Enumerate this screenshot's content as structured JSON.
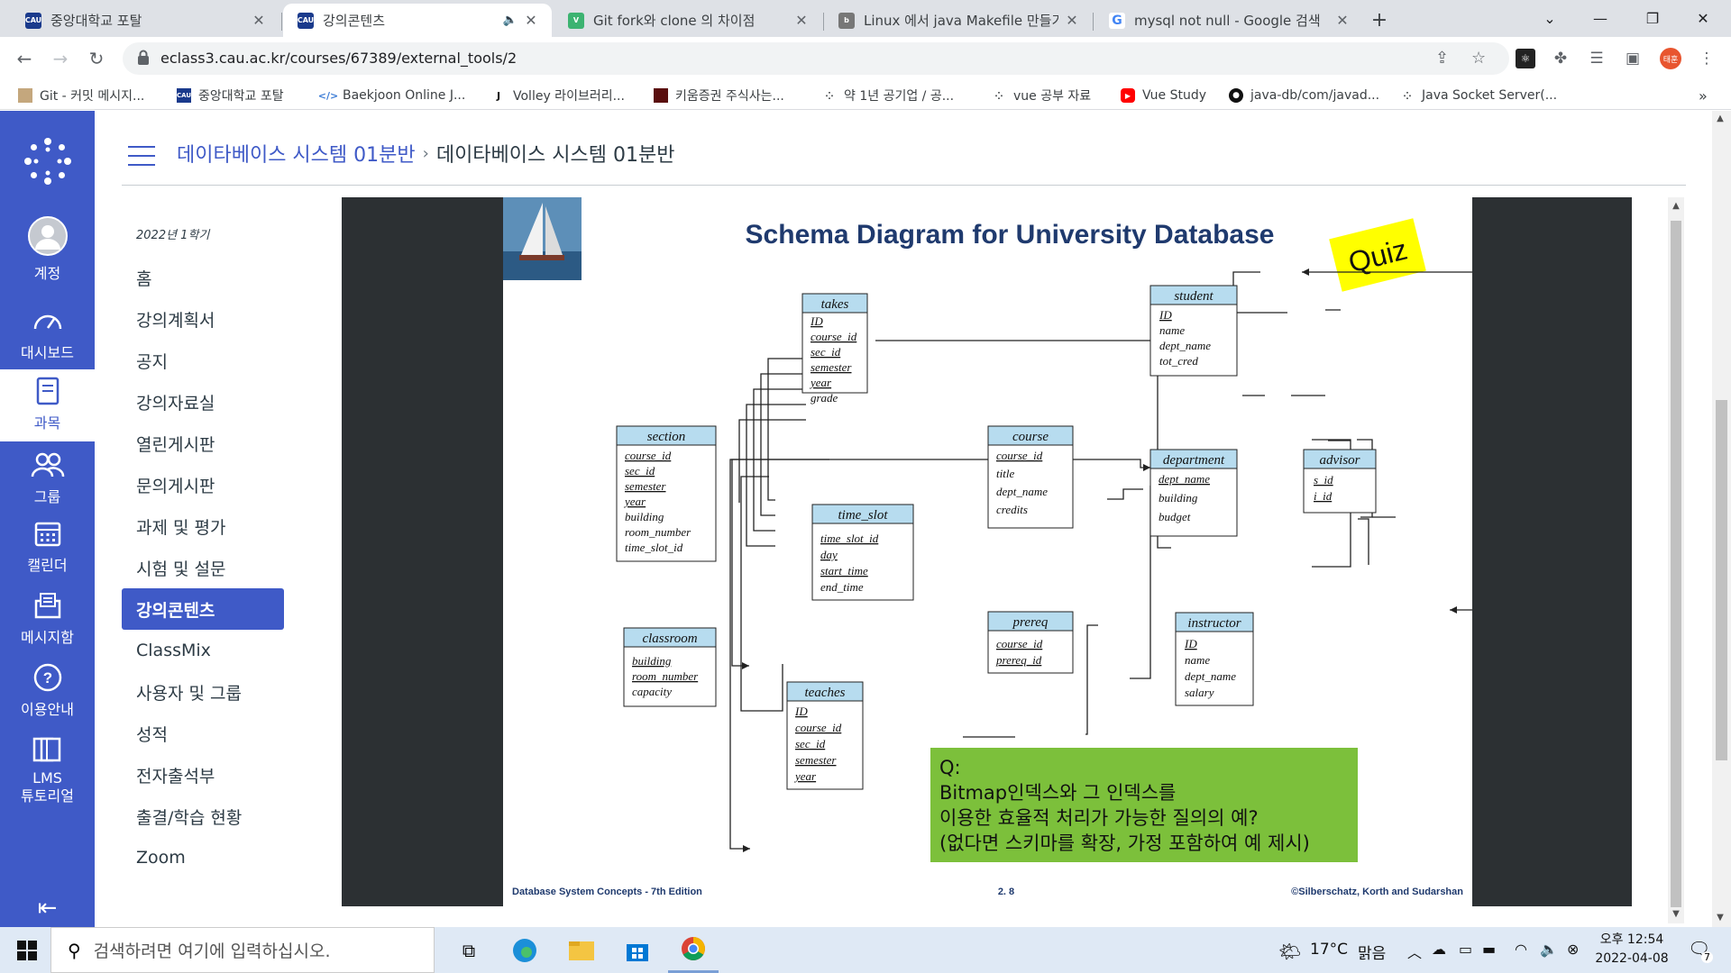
{
  "browser": {
    "tabs": [
      {
        "title": "중앙대학교 포탈",
        "favicon": "CAU",
        "color": "#1a3a8c",
        "active": false
      },
      {
        "title": "강의콘텐츠",
        "favicon": "CAU",
        "color": "#1a3a8c",
        "active": true,
        "audio": true
      },
      {
        "title": "Git fork와 clone 의 차이점",
        "favicon": "V",
        "color": "#3cb371",
        "active": false
      },
      {
        "title": "Linux 에서 java Makefile 만들기",
        "favicon": "blog",
        "color": "#555555",
        "active": false
      },
      {
        "title": "mysql not null - Google 검색",
        "favicon": "G",
        "color": "#4285f4",
        "active": false
      }
    ],
    "url": "eclass3.cau.ac.kr/courses/67389/external_tools/2",
    "profile_initials": "태훈",
    "bookmarks": [
      {
        "label": "Git - 커밋 메시지...",
        "icon": "git-icon"
      },
      {
        "label": "중앙대학교 포탈",
        "icon": "CAU"
      },
      {
        "label": "Baekjoon Online J...",
        "icon": "code-icon"
      },
      {
        "label": "Volley 라이브러리...",
        "icon": "J"
      },
      {
        "label": "키움증권 주식사는...",
        "icon": "image-icon"
      },
      {
        "label": "약 1년 공기업 / 공...",
        "icon": "dots-icon"
      },
      {
        "label": "vue 공부 자료",
        "icon": "dots-icon"
      },
      {
        "label": "Vue Study",
        "icon": "youtube-icon"
      },
      {
        "label": "java-db/com/javad...",
        "icon": "github-icon"
      },
      {
        "label": "Java Socket Server(...",
        "icon": "dots-icon"
      }
    ]
  },
  "global_nav": [
    {
      "label": "계정",
      "icon": "account-icon"
    },
    {
      "label": "대시보드",
      "icon": "dashboard-icon"
    },
    {
      "label": "과목",
      "icon": "courses-icon",
      "active": true
    },
    {
      "label": "그룹",
      "icon": "groups-icon"
    },
    {
      "label": "캘린더",
      "icon": "calendar-icon"
    },
    {
      "label": "메시지함",
      "icon": "inbox-icon"
    },
    {
      "label": "이용안내",
      "icon": "help-icon"
    },
    {
      "label": "LMS",
      "label2": "튜토리얼",
      "icon": "tutorial-icon"
    }
  ],
  "breadcrumb": {
    "course": "데이타베이스 시스템 01분반",
    "current": "데이타베이스 시스템 01분반"
  },
  "course_nav": {
    "term": "2022년 1학기",
    "items": [
      "홈",
      "강의계획서",
      "공지",
      "강의자료실",
      "열린게시판",
      "문의게시판",
      "과제 및 평가",
      "시험 및 설문",
      "강의콘텐츠",
      "ClassMix",
      "사용자 및 그룹",
      "성적",
      "전자출석부",
      "출결/학습 현황",
      "Zoom"
    ],
    "active_index": 8
  },
  "slide": {
    "title": "Schema Diagram for University Database",
    "badge": "Quiz",
    "footer_left": "Database System Concepts - 7th Edition",
    "footer_center": "2. 8",
    "footer_right": "©Silberschatz, Korth and Sudarshan",
    "question_lines": [
      "Q:",
      "Bitmap인덱스와 그 인덱스를",
      "이용한 효율적 처리가 가능한 질의의 예?",
      "(없다면 스키마를 확장, 가정 포함하여 예 제시)"
    ],
    "tables": {
      "takes": {
        "name": "takes",
        "attrs": [
          "ID",
          "course_id",
          "sec_id",
          "semester",
          "year",
          "grade"
        ]
      },
      "student": {
        "name": "student",
        "attrs": [
          "ID",
          "name",
          "dept_name",
          "tot_cred"
        ]
      },
      "section": {
        "name": "section",
        "attrs": [
          "course_id",
          "sec_id",
          "semester",
          "year",
          "building",
          "room_number",
          "time_slot_id"
        ]
      },
      "course": {
        "name": "course",
        "attrs": [
          "course_id",
          "title",
          "dept_name",
          "credits"
        ]
      },
      "department": {
        "name": "department",
        "attrs": [
          "dept_name",
          "building",
          "budget"
        ]
      },
      "advisor": {
        "name": "advisor",
        "attrs": [
          "s_id",
          "i_id"
        ]
      },
      "time_slot": {
        "name": "time_slot",
        "attrs": [
          "time_slot_id",
          "day",
          "start_time",
          "end_time"
        ]
      },
      "prereq": {
        "name": "prereq",
        "attrs": [
          "course_id",
          "prereq_id"
        ]
      },
      "instructor": {
        "name": "instructor",
        "attrs": [
          "ID",
          "name",
          "dept_name",
          "salary"
        ]
      },
      "classroom": {
        "name": "classroom",
        "attrs": [
          "building",
          "room_number",
          "capacity"
        ]
      },
      "teaches": {
        "name": "teaches",
        "attrs": [
          "ID",
          "course_id",
          "sec_id",
          "semester",
          "year"
        ]
      }
    }
  },
  "taskbar": {
    "search_placeholder": "검색하려면 여기에 입력하십시오.",
    "weather_temp": "17°C",
    "weather_desc": "맑음",
    "time": "오후 12:54",
    "date": "2022-04-08",
    "notifications": "7"
  }
}
